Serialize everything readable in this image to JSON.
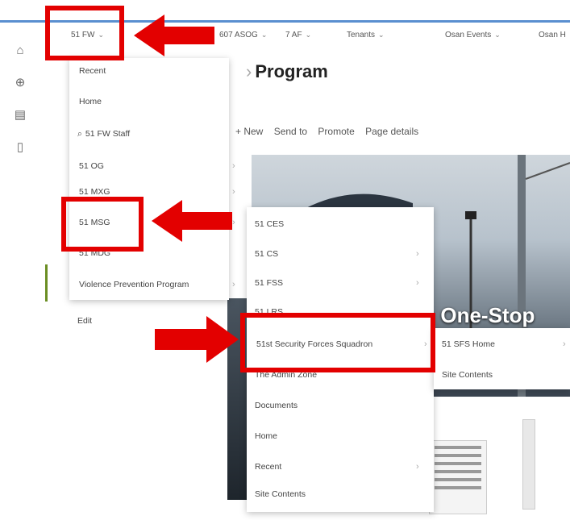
{
  "topnav": {
    "items": [
      {
        "label": "51 FW"
      },
      {
        "label": "607 ASOG"
      },
      {
        "label": "7 AF"
      },
      {
        "label": "Tenants"
      },
      {
        "label": "Osan Events"
      },
      {
        "label": "Osan H"
      }
    ]
  },
  "page": {
    "title": "Program",
    "hero_text": "m One-Stop"
  },
  "commandbar": {
    "new": "+ New",
    "send_to": "Send to",
    "promote": "Promote",
    "page_details": "Page details"
  },
  "menu1": {
    "items": [
      "Recent",
      "Home",
      "51 FW Staff",
      "51 OG",
      "51 MXG",
      "51 MSG",
      "51 MDG",
      "Violence Prevention Program"
    ],
    "edit": "Edit"
  },
  "menu2": {
    "items": [
      "51 CES",
      "51 CS",
      "51 FSS",
      "51 LRS",
      "51st Security Forces Squadron",
      "The Admin Zone",
      "Documents",
      "Home",
      "Recent",
      "Site Contents"
    ]
  },
  "menu3": {
    "items": [
      "51 SFS Home",
      "Site Contents"
    ]
  },
  "colors": {
    "annotation": "#e30000",
    "accent": "#5a8fd0"
  }
}
